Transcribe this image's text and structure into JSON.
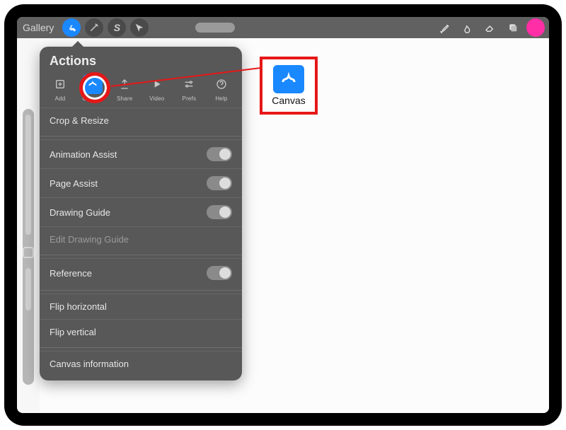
{
  "topbar": {
    "gallery": "Gallery",
    "icons": {
      "wrench": "wrench",
      "wand": "wand",
      "s": "S",
      "arrow": "arrow",
      "brush": "brush",
      "smudge": "smudge",
      "eraser": "eraser",
      "layers": "layers",
      "color": "color"
    }
  },
  "popover": {
    "title": "Actions",
    "tabs": {
      "add": "Add",
      "canvas": "Canvas",
      "share": "Share",
      "video": "Video",
      "prefs": "Prefs",
      "help": "Help"
    },
    "rows": {
      "crop": "Crop & Resize",
      "anim": "Animation Assist",
      "page": "Page Assist",
      "guide": "Drawing Guide",
      "editguide": "Edit Drawing Guide",
      "reference": "Reference",
      "fliph": "Flip horizontal",
      "flipv": "Flip vertical",
      "info": "Canvas information"
    }
  },
  "callout": {
    "label": "Canvas"
  }
}
